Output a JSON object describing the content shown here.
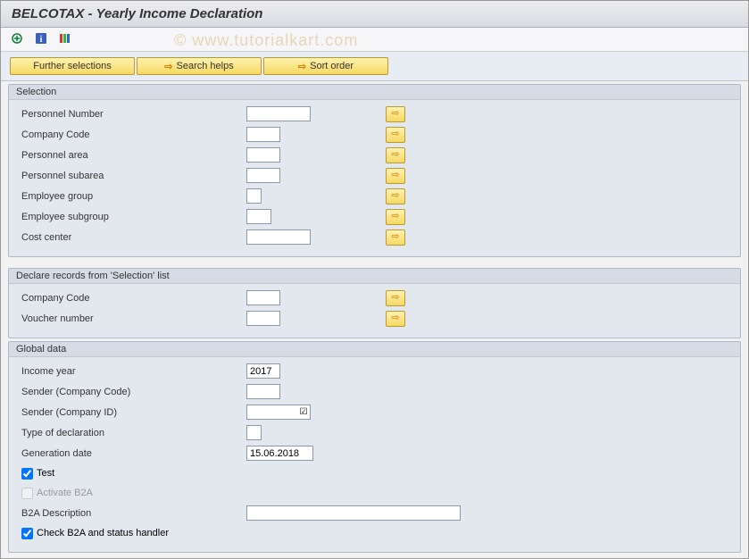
{
  "title": "BELCOTAX - Yearly Income Declaration",
  "watermark": "© www.tutorialkart.com",
  "buttons": {
    "further_selections": "Further selections",
    "search_helps": "Search helps",
    "sort_order": "Sort order"
  },
  "groups": {
    "selection": {
      "title": "Selection",
      "fields": {
        "personnel_number": {
          "label": "Personnel Number",
          "value": ""
        },
        "company_code": {
          "label": "Company Code",
          "value": ""
        },
        "personnel_area": {
          "label": "Personnel area",
          "value": ""
        },
        "personnel_subarea": {
          "label": "Personnel subarea",
          "value": ""
        },
        "employee_group": {
          "label": "Employee group",
          "value": ""
        },
        "employee_subgroup": {
          "label": "Employee subgroup",
          "value": ""
        },
        "cost_center": {
          "label": "Cost center",
          "value": ""
        }
      }
    },
    "declare": {
      "title": "Declare records from 'Selection' list",
      "fields": {
        "company_code": {
          "label": "Company Code",
          "value": ""
        },
        "voucher_number": {
          "label": "Voucher number",
          "value": ""
        }
      }
    },
    "global": {
      "title": "Global data",
      "fields": {
        "income_year": {
          "label": "Income year",
          "value": "2017"
        },
        "sender_code": {
          "label": "Sender (Company Code)",
          "value": ""
        },
        "sender_id": {
          "label": "Sender (Company ID)",
          "value": ""
        },
        "decl_type": {
          "label": "Type of declaration",
          "value": ""
        },
        "gen_date": {
          "label": "Generation date",
          "value": "15.06.2018"
        },
        "test": {
          "label": "Test",
          "checked": true
        },
        "activate_b2a": {
          "label": "Activate B2A",
          "checked": false
        },
        "b2a_desc": {
          "label": "B2A Description",
          "value": ""
        },
        "check_b2a": {
          "label": "Check B2A and status handler",
          "checked": true
        }
      }
    }
  }
}
